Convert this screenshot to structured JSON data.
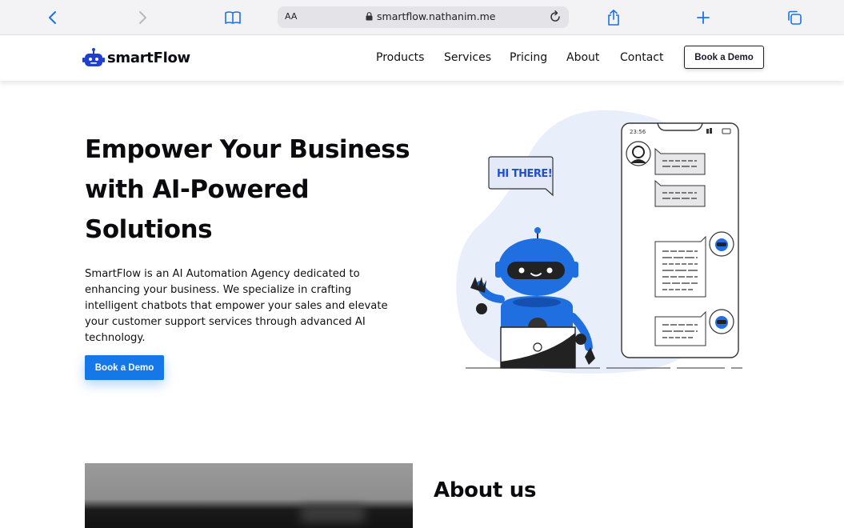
{
  "browser": {
    "text_size_label": "AA",
    "url": "smartflow.nathanim.me"
  },
  "header": {
    "brand": "smartFlow",
    "nav": [
      "Products",
      "Services",
      "Pricing",
      "About",
      "Contact"
    ],
    "cta_label": "Book a Demo"
  },
  "hero": {
    "title": "Empower Your Business with AI-Powered Solutions",
    "description": "SmartFlow is an AI Automation Agency dedicated to enhancing your business. We specialize in crafting intelligent chatbots that empower your sales and elevate your customer support services through advanced AI technology.",
    "cta_label": "Book a Demo",
    "illustration": {
      "bubble_text": "HI THERE!",
      "phone_time": "23:56"
    }
  },
  "about": {
    "title": "About us"
  },
  "colors": {
    "accent": "#1577e8",
    "robot_blue": "#1f6fe0",
    "blob": "#e9eefb"
  }
}
